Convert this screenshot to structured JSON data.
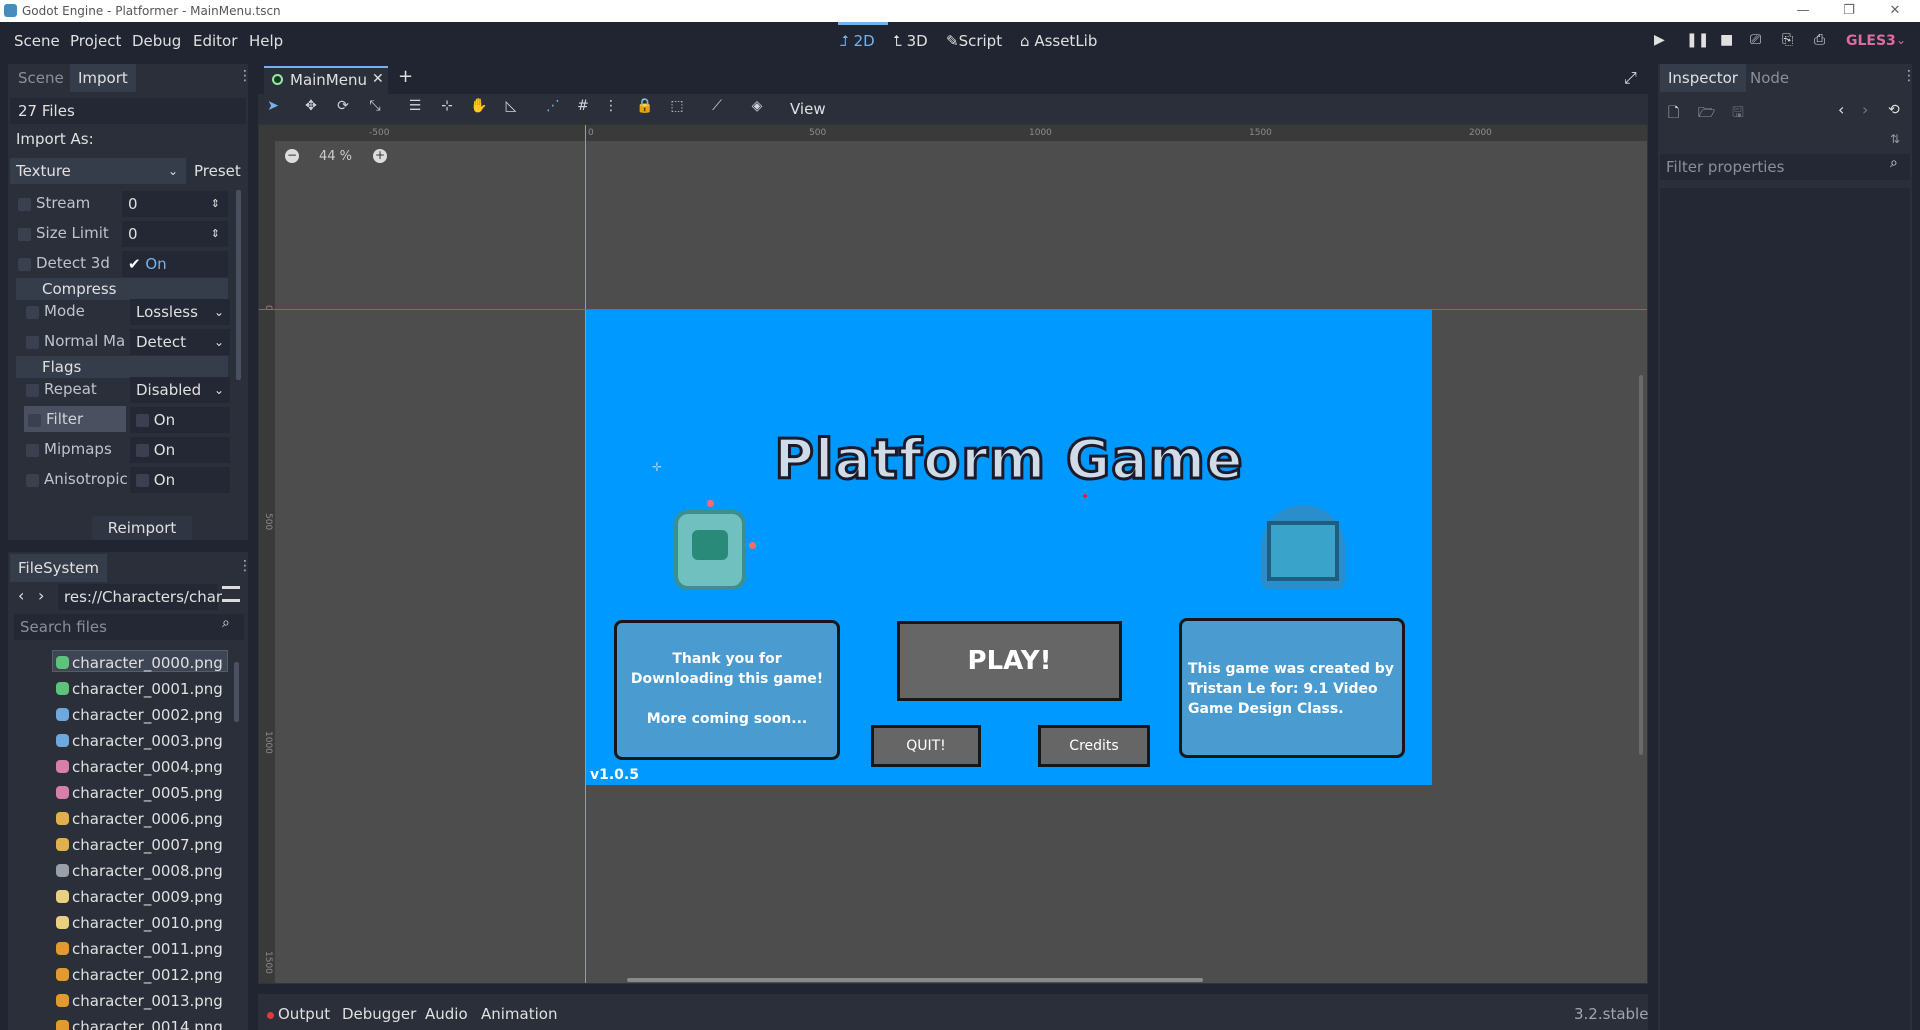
{
  "window_title": "Godot Engine - Platformer - MainMenu.tscn",
  "menu": [
    "Scene",
    "Project",
    "Debug",
    "Editor",
    "Help"
  ],
  "modes": {
    "m2d": "2D",
    "m3d": "3D",
    "script": "Script",
    "assetlib": "AssetLib"
  },
  "renderer": "GLES3",
  "left_dock": {
    "tabs": [
      "Scene",
      "Import"
    ],
    "files_count": "27 Files",
    "import_as_label": "Import As:",
    "import_as_value": "Texture",
    "preset_label": "Preset",
    "props": [
      {
        "label": "Stream",
        "value": "0"
      },
      {
        "label": "Size Limit",
        "value": "0"
      },
      {
        "label": "Detect 3d",
        "value": "On"
      }
    ],
    "compress_label": "Compress",
    "compress_props": [
      {
        "label": "Mode",
        "value": "Lossless"
      },
      {
        "label": "Normal Ma",
        "value": "Detect"
      }
    ],
    "flags_label": "Flags",
    "flags_props": [
      {
        "label": "Repeat",
        "value": "Disabled"
      },
      {
        "label": "Filter",
        "value": "On"
      },
      {
        "label": "Mipmaps",
        "value": "On"
      },
      {
        "label": "Anisotropic",
        "value": "On"
      }
    ],
    "reimport_label": "Reimport"
  },
  "filesystem": {
    "tab": "FileSystem",
    "path": "res://Characters/char",
    "search_placeholder": "Search files",
    "files": [
      "character_0000.png",
      "character_0001.png",
      "character_0002.png",
      "character_0003.png",
      "character_0004.png",
      "character_0005.png",
      "character_0006.png",
      "character_0007.png",
      "character_0008.png",
      "character_0009.png",
      "character_0010.png",
      "character_0011.png",
      "character_0012.png",
      "character_0013.png",
      "character_0014.png"
    ],
    "icon_colors": [
      "#5ec27a",
      "#5ec27a",
      "#6fa8dc",
      "#6fa8dc",
      "#d67fa8",
      "#d67fa8",
      "#e0b050",
      "#e0b050",
      "#9aa0a8",
      "#e8d080",
      "#e8d080",
      "#e09a30",
      "#e09a30",
      "#e09a30",
      "#e09a30"
    ]
  },
  "scene_tab": "MainMenu",
  "viewport": {
    "zoom": "44 %",
    "view_label": "View",
    "ruler": [
      "-500",
      "0",
      "500",
      "1000",
      "1500",
      "2000"
    ],
    "vruler": [
      "0",
      "500",
      "1000",
      "1500"
    ]
  },
  "game": {
    "title": "Platform Game",
    "play": "PLAY!",
    "quit": "QUIT!",
    "credits": "Credits",
    "left_box": "Thank you for Downloading this game!\n\nMore coming soon...",
    "right_box": "This game was created by Tristan Le for: 9.1 Video Game Design Class.",
    "version": "v1.0.5",
    "bg_color": "#0099ff"
  },
  "bottom": {
    "tabs": [
      "Output",
      "Debugger",
      "Audio",
      "Animation"
    ],
    "version": "3.2.stable"
  },
  "inspector": {
    "tabs": [
      "Inspector",
      "Node"
    ],
    "filter_placeholder": "Filter properties"
  }
}
